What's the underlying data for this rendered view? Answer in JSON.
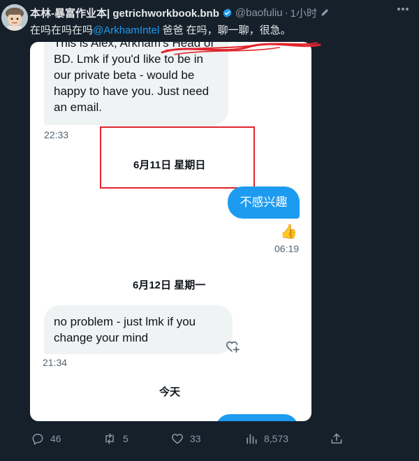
{
  "tweet": {
    "author_name": "本林-暴富作业本| getrichworkbook.bnb",
    "handle": "@baofuliu",
    "time_sep": "·",
    "time": "1小时",
    "text_before": "在吗在吗在吗",
    "mention": "@ArkhamIntel",
    "text_after": " 爸爸 在吗，聊一聊，很急。"
  },
  "dm": {
    "messages": [
      {
        "side": "left",
        "text": "This is Alex, Arkham's Head of BD. Lmk if you'd like to be in our private beta - would be happy to have you. Just need an email.",
        "time": "22:33"
      },
      {
        "type": "date",
        "text": "6月11日 星期日"
      },
      {
        "side": "right",
        "text": "不感兴趣",
        "reaction": "👍",
        "time": "06:19"
      },
      {
        "type": "date",
        "text": "6月12日 星期一"
      },
      {
        "side": "left",
        "text": "no problem - just lmk if you change your mind",
        "time": "21:34"
      },
      {
        "type": "date",
        "text": "今天"
      }
    ]
  },
  "actions": {
    "replies": "46",
    "retweets": "5",
    "likes": "33",
    "views": "8,573"
  },
  "colors": {
    "background": "#15202b",
    "accent": "#1d9bf0",
    "highlight_box": "#e0252b"
  },
  "icons": [
    "verified-icon",
    "edit-icon",
    "more-icon",
    "reply-icon",
    "retweet-icon",
    "like-icon",
    "views-icon",
    "share-icon",
    "add-reaction-icon"
  ]
}
